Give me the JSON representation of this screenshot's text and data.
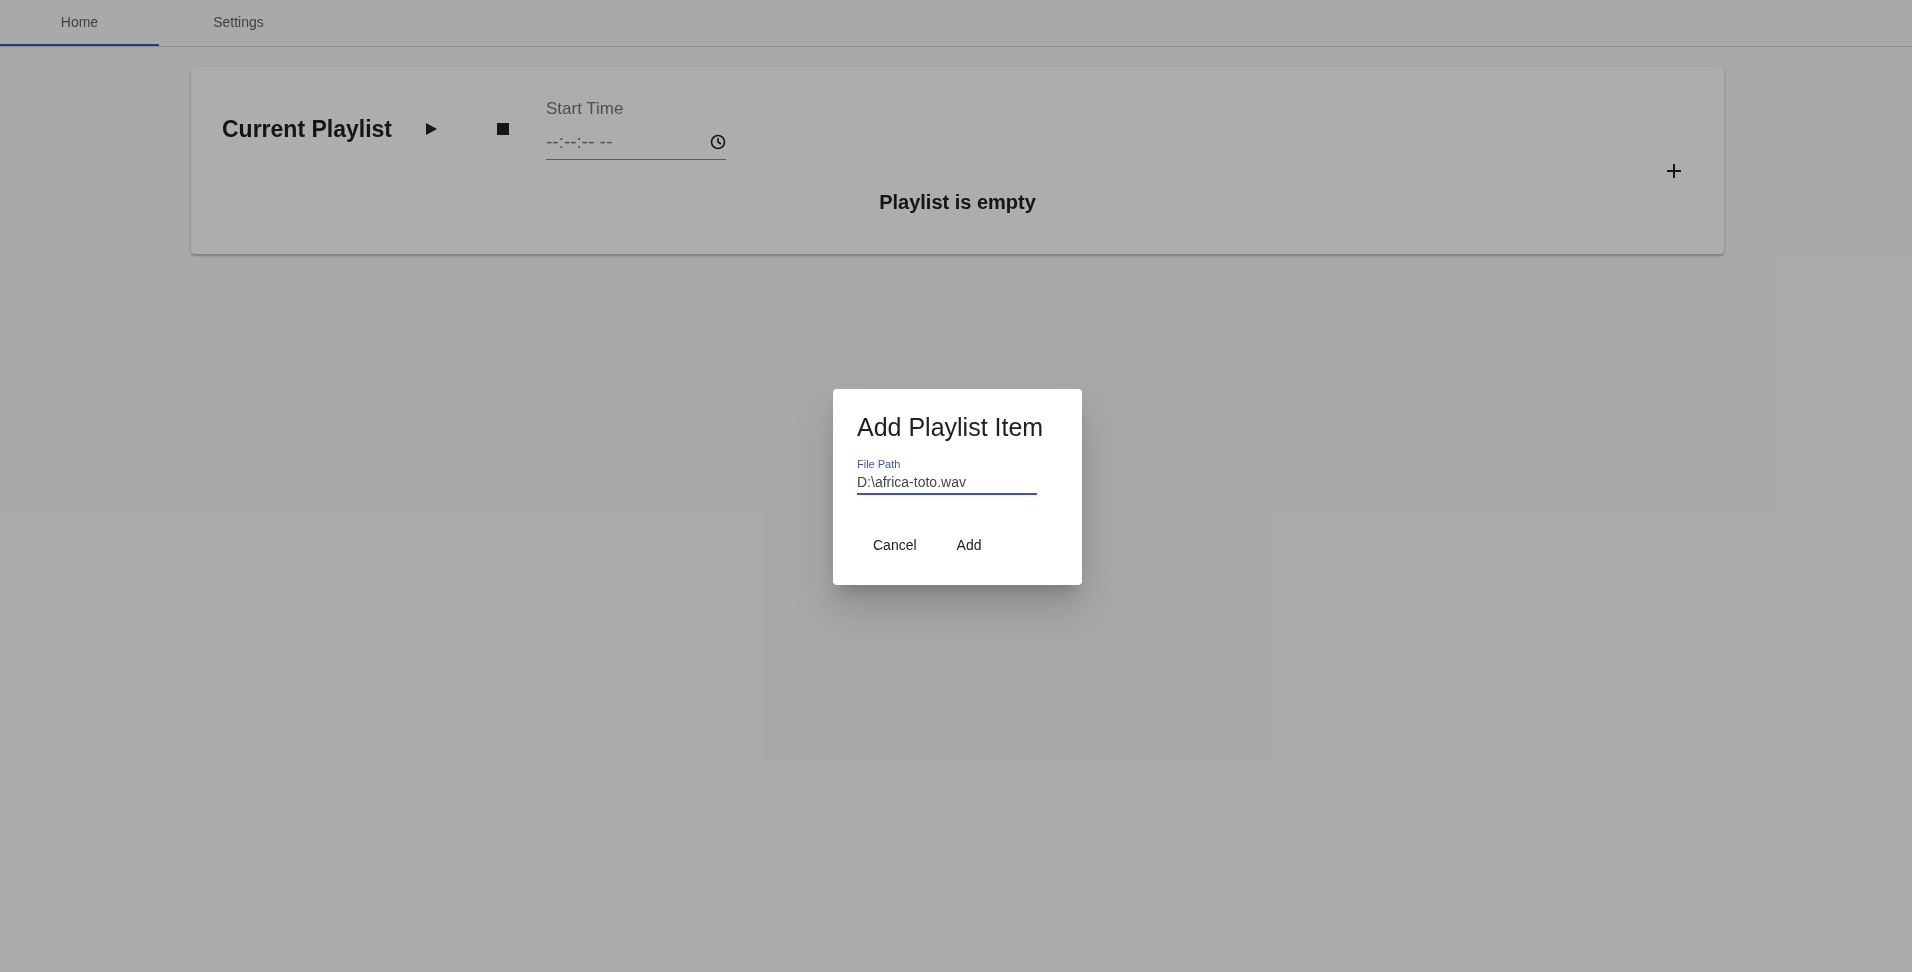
{
  "tabs": [
    {
      "label": "Home",
      "selected": true
    },
    {
      "label": "Settings",
      "selected": false
    }
  ],
  "playlist": {
    "title": "Current Playlist",
    "start_time": {
      "label": "Start Time",
      "value": "--:--:-- --"
    },
    "empty_message": "Playlist is empty"
  },
  "dialog": {
    "title": "Add Playlist Item",
    "field": {
      "label": "File Path",
      "value": "D:\\africa-toto.wav",
      "focused": true
    },
    "buttons": [
      "Cancel",
      "Add"
    ]
  }
}
